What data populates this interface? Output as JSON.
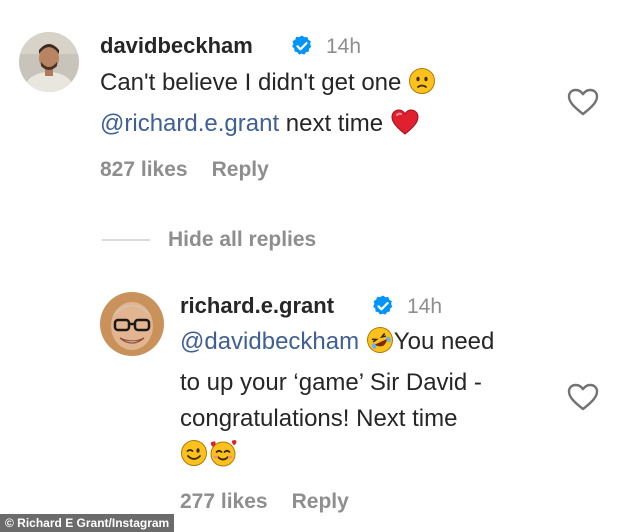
{
  "comments": [
    {
      "username": "davidbeckham",
      "time": "14h",
      "line1": "Can't believe I didn't get one ",
      "mention": "@richard.e.grant",
      "line2_rest": " next time ",
      "likes": "827 likes",
      "reply": "Reply"
    },
    {
      "username": "richard.e.grant",
      "time": "14h",
      "mention": "@davidbeckham",
      "text_after_mention": "You need",
      "line2": "to up your ‘game’ Sir David -",
      "line3": "congratulations! Next time",
      "likes": "277 likes",
      "reply": "Reply"
    }
  ],
  "hide_replies": "Hide all replies",
  "caption": "© Richard E Grant/Instagram",
  "colors": {
    "text": "#262626",
    "muted": "#8e8e8e",
    "mention": "#3f5f95",
    "verified": "#0095f6",
    "heart_emoji": "#e0202f"
  },
  "icons": [
    "verified-badge-icon",
    "like-heart-icon",
    "worried-face-emoji",
    "red-heart-emoji",
    "rolling-laughing-emoji",
    "winking-face-emoji",
    "smiling-hearts-emoji"
  ]
}
